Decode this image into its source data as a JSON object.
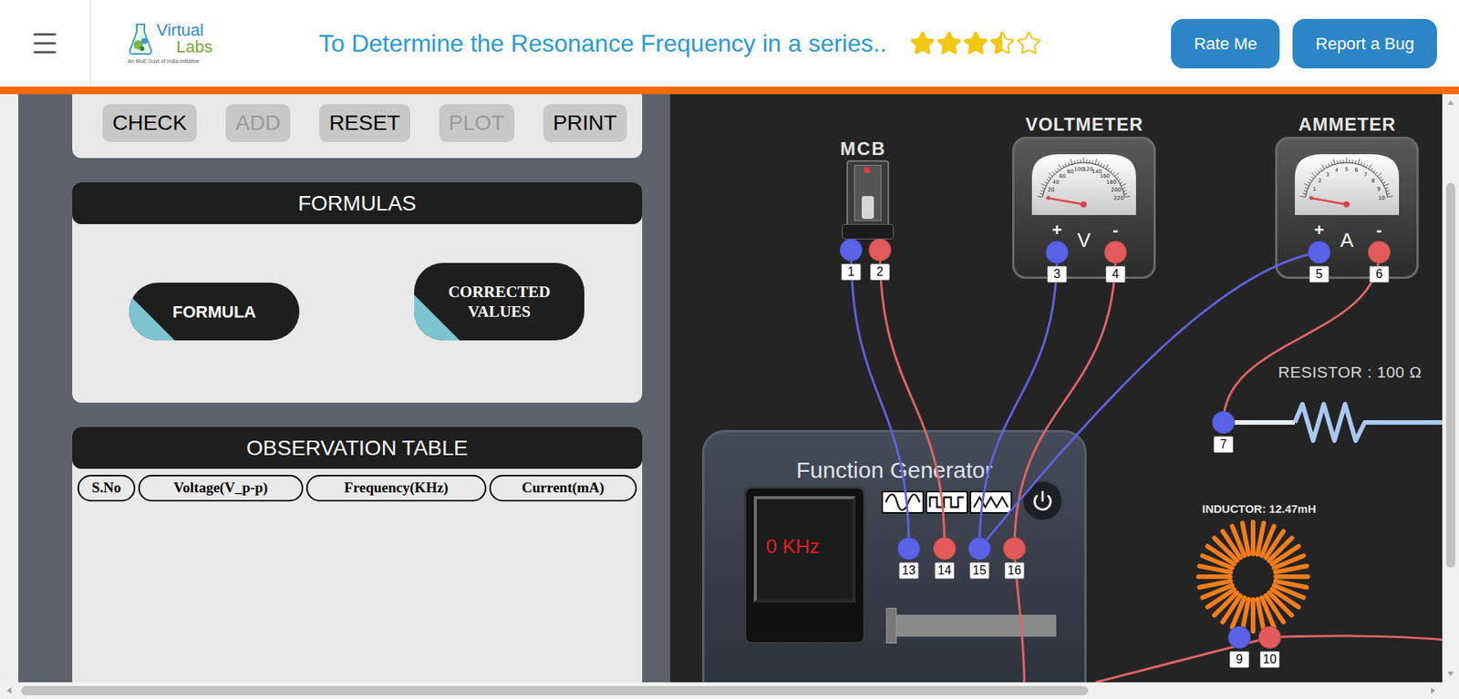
{
  "header": {
    "logo": {
      "primary": "Virtual",
      "secondary": "Labs",
      "tagline": "An MoE Govt of India Initiative"
    },
    "title": "To Determine the Resonance Frequency in a series..",
    "rating": {
      "stars": 3.5,
      "max": 5
    },
    "buttons": [
      "Rate Me",
      "Report a Bug"
    ]
  },
  "controls": [
    {
      "label": "CHECK",
      "disabled": false
    },
    {
      "label": "ADD",
      "disabled": true
    },
    {
      "label": "RESET",
      "disabled": false
    },
    {
      "label": "PLOT",
      "disabled": true
    },
    {
      "label": "PRINT",
      "disabled": false
    }
  ],
  "formulas": {
    "title": "FORMULAS",
    "buttons": [
      "FORMULA",
      "CORRECTED VALUES"
    ]
  },
  "observation_table": {
    "title": "OBSERVATION TABLE",
    "columns": [
      "S.No",
      "Voltage(V_p-p)",
      "Frequency(KHz)",
      "Current(mA)"
    ],
    "rows": []
  },
  "circuit": {
    "mcb": {
      "label": "MCB",
      "on": false,
      "terminals": [
        {
          "number": "1",
          "color": "#5a62e8"
        },
        {
          "number": "2",
          "color": "#e35a5a"
        }
      ]
    },
    "voltmeter": {
      "label": "VOLTMETER",
      "unit": "V",
      "level": 0,
      "scale": [
        "0",
        "20",
        "40",
        "60",
        "80",
        "100",
        "120",
        "140",
        "160",
        "180",
        "200",
        "220"
      ],
      "terminals": [
        {
          "number": "3",
          "sign": "+",
          "color": "#5a62e8"
        },
        {
          "number": "4",
          "sign": "-",
          "color": "#e35a5a"
        }
      ]
    },
    "ammeter": {
      "label": "AMMETER",
      "unit": "A",
      "level": 0,
      "scale": [
        "0",
        "1",
        "2",
        "3",
        "4",
        "5",
        "6",
        "7",
        "8",
        "9",
        "10"
      ],
      "terminals": [
        {
          "number": "5",
          "sign": "+",
          "color": "#5a62e8"
        },
        {
          "number": "6",
          "sign": "-",
          "color": "#e35a5a"
        }
      ]
    },
    "resistor": {
      "label": "RESISTOR : 100 Ω",
      "terminals": [
        {
          "number": "7",
          "color": "#5a62e8"
        }
      ]
    },
    "inductor": {
      "label": "INDUCTOR: 12.47mH",
      "terminals": [
        {
          "number": "9",
          "color": "#5a62e8"
        },
        {
          "number": "10",
          "color": "#e35a5a"
        }
      ]
    },
    "function_generator": {
      "label": "Function Generator",
      "display": "0 KHz",
      "power": false,
      "level": 0,
      "waveforms": [
        {
          "kind": "sine",
          "selected": false
        },
        {
          "kind": "square",
          "selected": false
        },
        {
          "kind": "triangle",
          "selected": false
        }
      ],
      "terminals": [
        {
          "number": "13",
          "color": "#5a62e8"
        },
        {
          "number": "14",
          "color": "#e35a5a"
        },
        {
          "number": "15",
          "color": "#5a62e8"
        },
        {
          "number": "16",
          "color": "#e35a5a"
        }
      ]
    },
    "wires": [
      {
        "from": "1",
        "to": "13",
        "color": "#5b63e0"
      },
      {
        "from": "2",
        "to": "14",
        "color": "#e06464"
      },
      {
        "from": "3",
        "to": "15",
        "color": "#5b63e0"
      },
      {
        "from": "4",
        "to": "16",
        "color": "#e06464"
      },
      {
        "from": "5",
        "to": "15",
        "color": "#5b63e0"
      },
      {
        "from": "6",
        "to": "7",
        "color": "#e06464"
      }
    ]
  }
}
